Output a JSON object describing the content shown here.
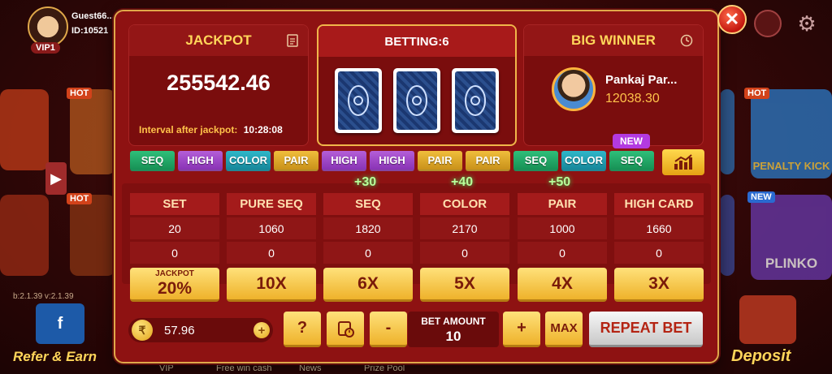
{
  "lobby": {
    "username": "Guest66...",
    "user_id": "ID:10521",
    "vip": "VIP1",
    "version": "b:2.1.39  v:2.1.39",
    "refer_label": "Refer & Earn",
    "deposit_label": "Deposit",
    "nav": [
      "VIP",
      "Free win cash",
      "News",
      "Prize Pool"
    ],
    "games": [
      "PENALTY KICK",
      "PLINKO"
    ],
    "hot_tag": "HOT",
    "new_tag": "NEW"
  },
  "jackpot": {
    "title": "JACKPOT",
    "value": "255542.46",
    "interval_label": "Interval after jackpot:",
    "interval_time": "10:28:08"
  },
  "betting": {
    "title": "BETTING:6"
  },
  "big_winner": {
    "title": "BIG WINNER",
    "name": "Pankaj Par...",
    "amount": "12038.30"
  },
  "history": {
    "new_label": "NEW",
    "chips": [
      {
        "label": "SEQ",
        "kind": "seq"
      },
      {
        "label": "HIGH",
        "kind": "high"
      },
      {
        "label": "COLOR",
        "kind": "color"
      },
      {
        "label": "PAIR",
        "kind": "pair"
      },
      {
        "label": "HIGH",
        "kind": "high"
      },
      {
        "label": "HIGH",
        "kind": "high"
      },
      {
        "label": "PAIR",
        "kind": "pair"
      },
      {
        "label": "PAIR",
        "kind": "pair"
      },
      {
        "label": "SEQ",
        "kind": "seq"
      },
      {
        "label": "COLOR",
        "kind": "color"
      },
      {
        "label": "SEQ",
        "kind": "seq"
      }
    ]
  },
  "bets": {
    "columns": [
      {
        "name": "SET",
        "total": "20",
        "mine": "0",
        "multiplier": "JACKPOT 20%",
        "bonus": ""
      },
      {
        "name": "PURE SEQ",
        "total": "1060",
        "mine": "0",
        "multiplier": "10X",
        "bonus": ""
      },
      {
        "name": "SEQ",
        "total": "1820",
        "mine": "0",
        "multiplier": "6X",
        "bonus": "+30"
      },
      {
        "name": "COLOR",
        "total": "2170",
        "mine": "0",
        "multiplier": "5X",
        "bonus": "+40"
      },
      {
        "name": "PAIR",
        "total": "1000",
        "mine": "0",
        "multiplier": "4X",
        "bonus": "+50"
      },
      {
        "name": "HIGH CARD",
        "total": "1660",
        "mine": "0",
        "multiplier": "3X",
        "bonus": ""
      }
    ],
    "jackpot_small": "JACKPOT",
    "jackpot_big": "20%"
  },
  "controls": {
    "balance": "57.96",
    "coin_symbol": "₹",
    "help_label": "?",
    "minus_label": "-",
    "plus_label": "+",
    "bet_amount_label": "BET AMOUNT",
    "bet_amount": "10",
    "max_label": "MAX",
    "repeat_label": "REPEAT BET"
  },
  "colors": {
    "modal": "#8e1212",
    "gold": "#ffd65a",
    "seq": "#1fa865",
    "high": "#9b45c6",
    "color": "#20a1b4",
    "pair": "#dfa62a"
  }
}
